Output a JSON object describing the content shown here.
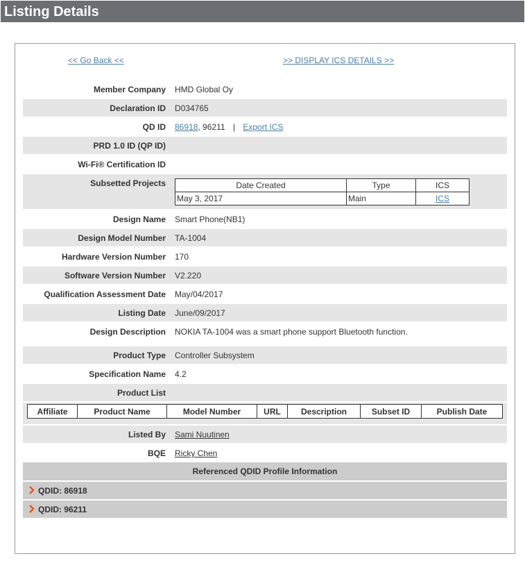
{
  "page_title": "Listing Details",
  "nav": {
    "go_back": "<< Go Back <<",
    "display_ics": ">> DISPLAY ICS DETAILS >>"
  },
  "fields": {
    "member_company": {
      "label": "Member Company",
      "value": "HMD Global Oy"
    },
    "declaration_id": {
      "label": "Declaration ID",
      "value": "D034765"
    },
    "qd_id": {
      "label": "QD ID",
      "link": "86918",
      "rest": ", 96211",
      "sep": "|",
      "export": "Export ICS"
    },
    "prd_id": {
      "label": "PRD 1.0 ID (QP ID)",
      "value": ""
    },
    "wifi_id": {
      "label": "Wi-Fi® Certification ID",
      "value": ""
    },
    "subsetted_projects": {
      "label": "Subsetted Projects"
    },
    "design_name": {
      "label": "Design Name",
      "value": "Smart Phone(NB1)"
    },
    "design_model_number": {
      "label": "Design Model Number",
      "value": "TA-1004"
    },
    "hardware_version": {
      "label": "Hardware Version Number",
      "value": "170"
    },
    "software_version": {
      "label": "Software Version Number",
      "value": "V2.220"
    },
    "qualification_date": {
      "label": "Qualification Assessment Date",
      "value": "May/04/2017"
    },
    "listing_date": {
      "label": "Listing Date",
      "value": "June/09/2017"
    },
    "design_description": {
      "label": "Design Description",
      "value": "NOKIA TA-1004 was a smart phone support Bluetooth function."
    },
    "product_type": {
      "label": "Product Type",
      "value": "Controller Subsystem"
    },
    "specification_name": {
      "label": "Specification Name",
      "value": "4.2"
    },
    "product_list": {
      "label": "Product List"
    },
    "listed_by": {
      "label": "Listed By",
      "value": "Sami Nuutinen"
    },
    "bqe": {
      "label": "BQE",
      "value": "Ricky Chen"
    }
  },
  "subset_table": {
    "headers": {
      "date": "Date Created",
      "type": "Type",
      "ics": "ICS"
    },
    "rows": [
      {
        "date": "May 3, 2017",
        "type": "Main",
        "ics": "ICS"
      }
    ]
  },
  "product_table": {
    "headers": [
      "Affiliate",
      "Product Name",
      "Model Number",
      "URL",
      "Description",
      "Subset ID",
      "Publish Date"
    ]
  },
  "referenced": {
    "title": "Referenced QDID Profile Information",
    "items": [
      "QDID: 86918",
      "QDID: 96211"
    ]
  },
  "colors": {
    "header_bg": "#6b6e72",
    "link": "#4a7ea6",
    "row_shade": "#e5e5e5",
    "section_bg": "#cccccc",
    "chevron": "#e8561c"
  }
}
